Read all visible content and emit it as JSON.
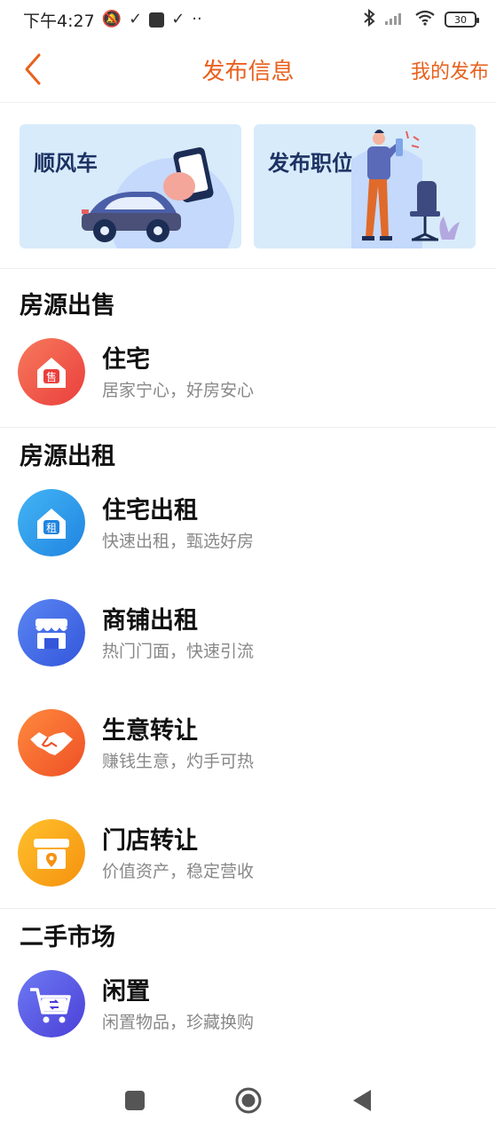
{
  "status_bar": {
    "time": "下午4:27",
    "icons_left": [
      "silent-icon",
      "check-icon",
      "app-square-icon",
      "check-icon",
      "more-dots-icon"
    ],
    "icons_right": [
      "bluetooth-icon",
      "signal-icon",
      "wifi-icon"
    ],
    "battery": "30"
  },
  "header": {
    "title": "发布信息",
    "right_action": "我的发布"
  },
  "banners": [
    {
      "label": "顺风车",
      "icon": "car-phone-illustration"
    },
    {
      "label": "发布职位",
      "icon": "person-office-illustration"
    }
  ],
  "sections": [
    {
      "title": "房源出售",
      "items": [
        {
          "title": "住宅",
          "subtitle": "居家宁心，好房安心",
          "icon": "house-sale-icon",
          "icon_text": "售",
          "color": "#f0533f"
        }
      ]
    },
    {
      "title": "房源出租",
      "items": [
        {
          "title": "住宅出租",
          "subtitle": "快速出租，甄选好房",
          "icon": "house-rent-icon",
          "icon_text": "租",
          "color": "#2a95e8"
        },
        {
          "title": "商铺出租",
          "subtitle": "热门门面，快速引流",
          "icon": "shop-icon",
          "color": "#3e6ae6"
        },
        {
          "title": "生意转让",
          "subtitle": "赚钱生意，灼手可热",
          "icon": "handshake-icon",
          "color": "#f26a30"
        },
        {
          "title": "门店转让",
          "subtitle": "价值资产，稳定营收",
          "icon": "store-location-icon",
          "color": "#f7a11a"
        }
      ]
    },
    {
      "title": "二手市场",
      "items": [
        {
          "title": "闲置",
          "subtitle": "闲置物品，珍藏换购",
          "icon": "cart-exchange-icon",
          "color": "#5b57e6"
        }
      ]
    }
  ],
  "colors": {
    "accent": "#e8611d",
    "banner_bg": "#d8ebfb"
  },
  "nav_bar": [
    "recent-apps-icon",
    "home-icon",
    "back-triangle-icon"
  ]
}
